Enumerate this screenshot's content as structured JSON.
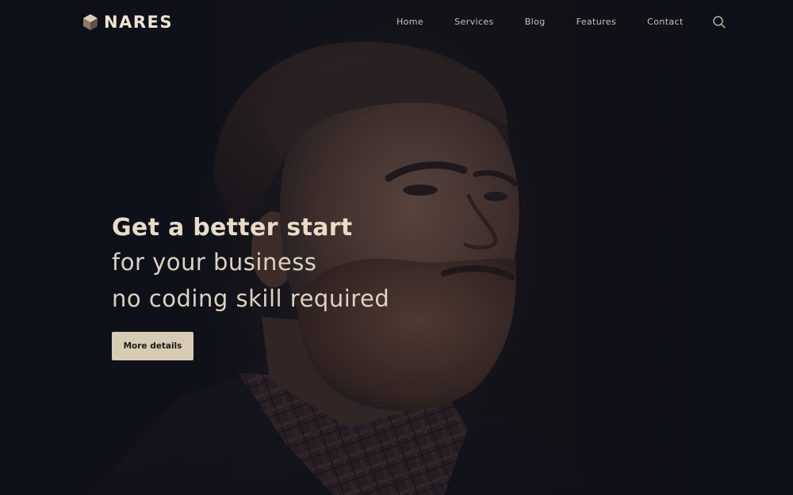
{
  "brand": {
    "name": "NARES",
    "logo_icon": "hexagon-cube-icon",
    "color": "#efe4d3"
  },
  "nav": {
    "items": [
      {
        "label": "Home"
      },
      {
        "label": "Services"
      },
      {
        "label": "Blog"
      },
      {
        "label": "Features"
      },
      {
        "label": "Contact"
      }
    ],
    "search_icon": "search-icon"
  },
  "hero": {
    "headline": "Get a better start",
    "line2": "for your business",
    "line3": "no coding skill required",
    "cta_label": "More details",
    "image": "portrait-photo"
  },
  "colors": {
    "background": "#0e1019",
    "text": "#e8dcc7",
    "button": "#d7cbb4"
  }
}
